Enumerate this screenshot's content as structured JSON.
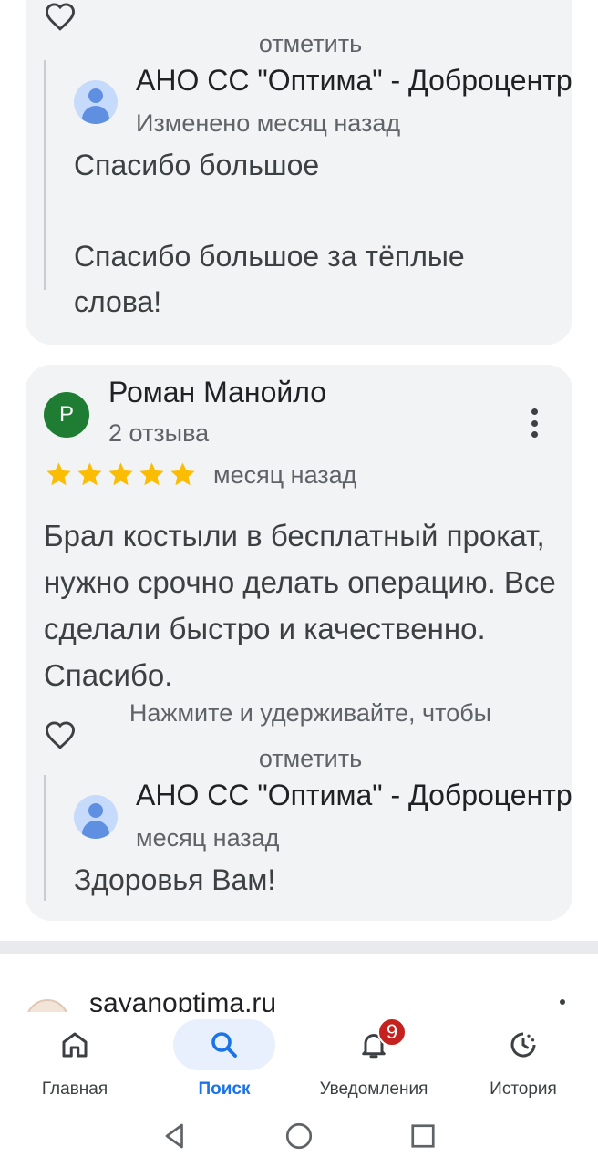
{
  "review_prev": {
    "hold_hint_tail": "отметить",
    "owner_reply": {
      "name": "АНО СС \"Оптима\" - Доброцентр",
      "meta": "Изменено месяц назад",
      "text": "Спасибо большое\n\nСпасибо большое за тёплые слова!"
    }
  },
  "review": {
    "avatar_letter": "Р",
    "author": "Роман Манойло",
    "reviews_count": "2 отзыва",
    "rating": 5,
    "time": "месяц назад",
    "text": "Брал костыли в бесплатный прокат, нужно срочно делать операцию. Все сделали быстро и качественно. Спасибо.",
    "hold_hint_line1": "Нажмите и удерживайте, чтобы",
    "hold_hint_line2": "отметить",
    "owner_reply": {
      "name": "АНО СС \"Оптима\" - Доброцентр",
      "meta": "месяц назад",
      "text": "Здоровья Вам!"
    }
  },
  "next_result": {
    "site": "sayanoptima.ru"
  },
  "bottom_nav": {
    "home": "Главная",
    "search": "Поиск",
    "notifications": "Уведомления",
    "notifications_badge": "9",
    "history": "История"
  },
  "colors": {
    "card_bg": "#f1f3f4",
    "star": "#fbbc04",
    "accent": "#1a73e8",
    "badge": "#c5221f",
    "reviewer_avatar": "#1e7d32"
  }
}
